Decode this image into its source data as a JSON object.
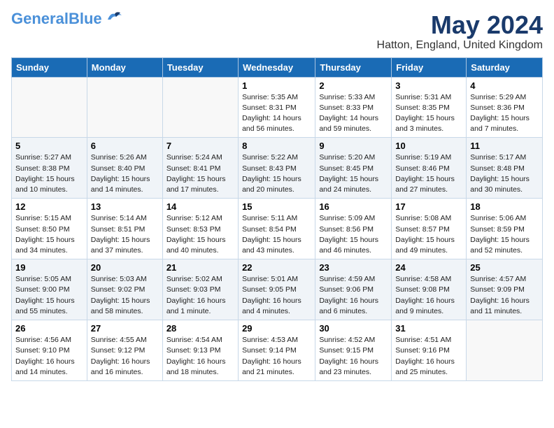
{
  "header": {
    "logo_general": "General",
    "logo_blue": "Blue",
    "month_title": "May 2024",
    "location": "Hatton, England, United Kingdom"
  },
  "days_of_week": [
    "Sunday",
    "Monday",
    "Tuesday",
    "Wednesday",
    "Thursday",
    "Friday",
    "Saturday"
  ],
  "weeks": [
    [
      {
        "day": "",
        "info": ""
      },
      {
        "day": "",
        "info": ""
      },
      {
        "day": "",
        "info": ""
      },
      {
        "day": "1",
        "info": "Sunrise: 5:35 AM\nSunset: 8:31 PM\nDaylight: 14 hours\nand 56 minutes."
      },
      {
        "day": "2",
        "info": "Sunrise: 5:33 AM\nSunset: 8:33 PM\nDaylight: 14 hours\nand 59 minutes."
      },
      {
        "day": "3",
        "info": "Sunrise: 5:31 AM\nSunset: 8:35 PM\nDaylight: 15 hours\nand 3 minutes."
      },
      {
        "day": "4",
        "info": "Sunrise: 5:29 AM\nSunset: 8:36 PM\nDaylight: 15 hours\nand 7 minutes."
      }
    ],
    [
      {
        "day": "5",
        "info": "Sunrise: 5:27 AM\nSunset: 8:38 PM\nDaylight: 15 hours\nand 10 minutes."
      },
      {
        "day": "6",
        "info": "Sunrise: 5:26 AM\nSunset: 8:40 PM\nDaylight: 15 hours\nand 14 minutes."
      },
      {
        "day": "7",
        "info": "Sunrise: 5:24 AM\nSunset: 8:41 PM\nDaylight: 15 hours\nand 17 minutes."
      },
      {
        "day": "8",
        "info": "Sunrise: 5:22 AM\nSunset: 8:43 PM\nDaylight: 15 hours\nand 20 minutes."
      },
      {
        "day": "9",
        "info": "Sunrise: 5:20 AM\nSunset: 8:45 PM\nDaylight: 15 hours\nand 24 minutes."
      },
      {
        "day": "10",
        "info": "Sunrise: 5:19 AM\nSunset: 8:46 PM\nDaylight: 15 hours\nand 27 minutes."
      },
      {
        "day": "11",
        "info": "Sunrise: 5:17 AM\nSunset: 8:48 PM\nDaylight: 15 hours\nand 30 minutes."
      }
    ],
    [
      {
        "day": "12",
        "info": "Sunrise: 5:15 AM\nSunset: 8:50 PM\nDaylight: 15 hours\nand 34 minutes."
      },
      {
        "day": "13",
        "info": "Sunrise: 5:14 AM\nSunset: 8:51 PM\nDaylight: 15 hours\nand 37 minutes."
      },
      {
        "day": "14",
        "info": "Sunrise: 5:12 AM\nSunset: 8:53 PM\nDaylight: 15 hours\nand 40 minutes."
      },
      {
        "day": "15",
        "info": "Sunrise: 5:11 AM\nSunset: 8:54 PM\nDaylight: 15 hours\nand 43 minutes."
      },
      {
        "day": "16",
        "info": "Sunrise: 5:09 AM\nSunset: 8:56 PM\nDaylight: 15 hours\nand 46 minutes."
      },
      {
        "day": "17",
        "info": "Sunrise: 5:08 AM\nSunset: 8:57 PM\nDaylight: 15 hours\nand 49 minutes."
      },
      {
        "day": "18",
        "info": "Sunrise: 5:06 AM\nSunset: 8:59 PM\nDaylight: 15 hours\nand 52 minutes."
      }
    ],
    [
      {
        "day": "19",
        "info": "Sunrise: 5:05 AM\nSunset: 9:00 PM\nDaylight: 15 hours\nand 55 minutes."
      },
      {
        "day": "20",
        "info": "Sunrise: 5:03 AM\nSunset: 9:02 PM\nDaylight: 15 hours\nand 58 minutes."
      },
      {
        "day": "21",
        "info": "Sunrise: 5:02 AM\nSunset: 9:03 PM\nDaylight: 16 hours\nand 1 minute."
      },
      {
        "day": "22",
        "info": "Sunrise: 5:01 AM\nSunset: 9:05 PM\nDaylight: 16 hours\nand 4 minutes."
      },
      {
        "day": "23",
        "info": "Sunrise: 4:59 AM\nSunset: 9:06 PM\nDaylight: 16 hours\nand 6 minutes."
      },
      {
        "day": "24",
        "info": "Sunrise: 4:58 AM\nSunset: 9:08 PM\nDaylight: 16 hours\nand 9 minutes."
      },
      {
        "day": "25",
        "info": "Sunrise: 4:57 AM\nSunset: 9:09 PM\nDaylight: 16 hours\nand 11 minutes."
      }
    ],
    [
      {
        "day": "26",
        "info": "Sunrise: 4:56 AM\nSunset: 9:10 PM\nDaylight: 16 hours\nand 14 minutes."
      },
      {
        "day": "27",
        "info": "Sunrise: 4:55 AM\nSunset: 9:12 PM\nDaylight: 16 hours\nand 16 minutes."
      },
      {
        "day": "28",
        "info": "Sunrise: 4:54 AM\nSunset: 9:13 PM\nDaylight: 16 hours\nand 18 minutes."
      },
      {
        "day": "29",
        "info": "Sunrise: 4:53 AM\nSunset: 9:14 PM\nDaylight: 16 hours\nand 21 minutes."
      },
      {
        "day": "30",
        "info": "Sunrise: 4:52 AM\nSunset: 9:15 PM\nDaylight: 16 hours\nand 23 minutes."
      },
      {
        "day": "31",
        "info": "Sunrise: 4:51 AM\nSunset: 9:16 PM\nDaylight: 16 hours\nand 25 minutes."
      },
      {
        "day": "",
        "info": ""
      }
    ]
  ]
}
